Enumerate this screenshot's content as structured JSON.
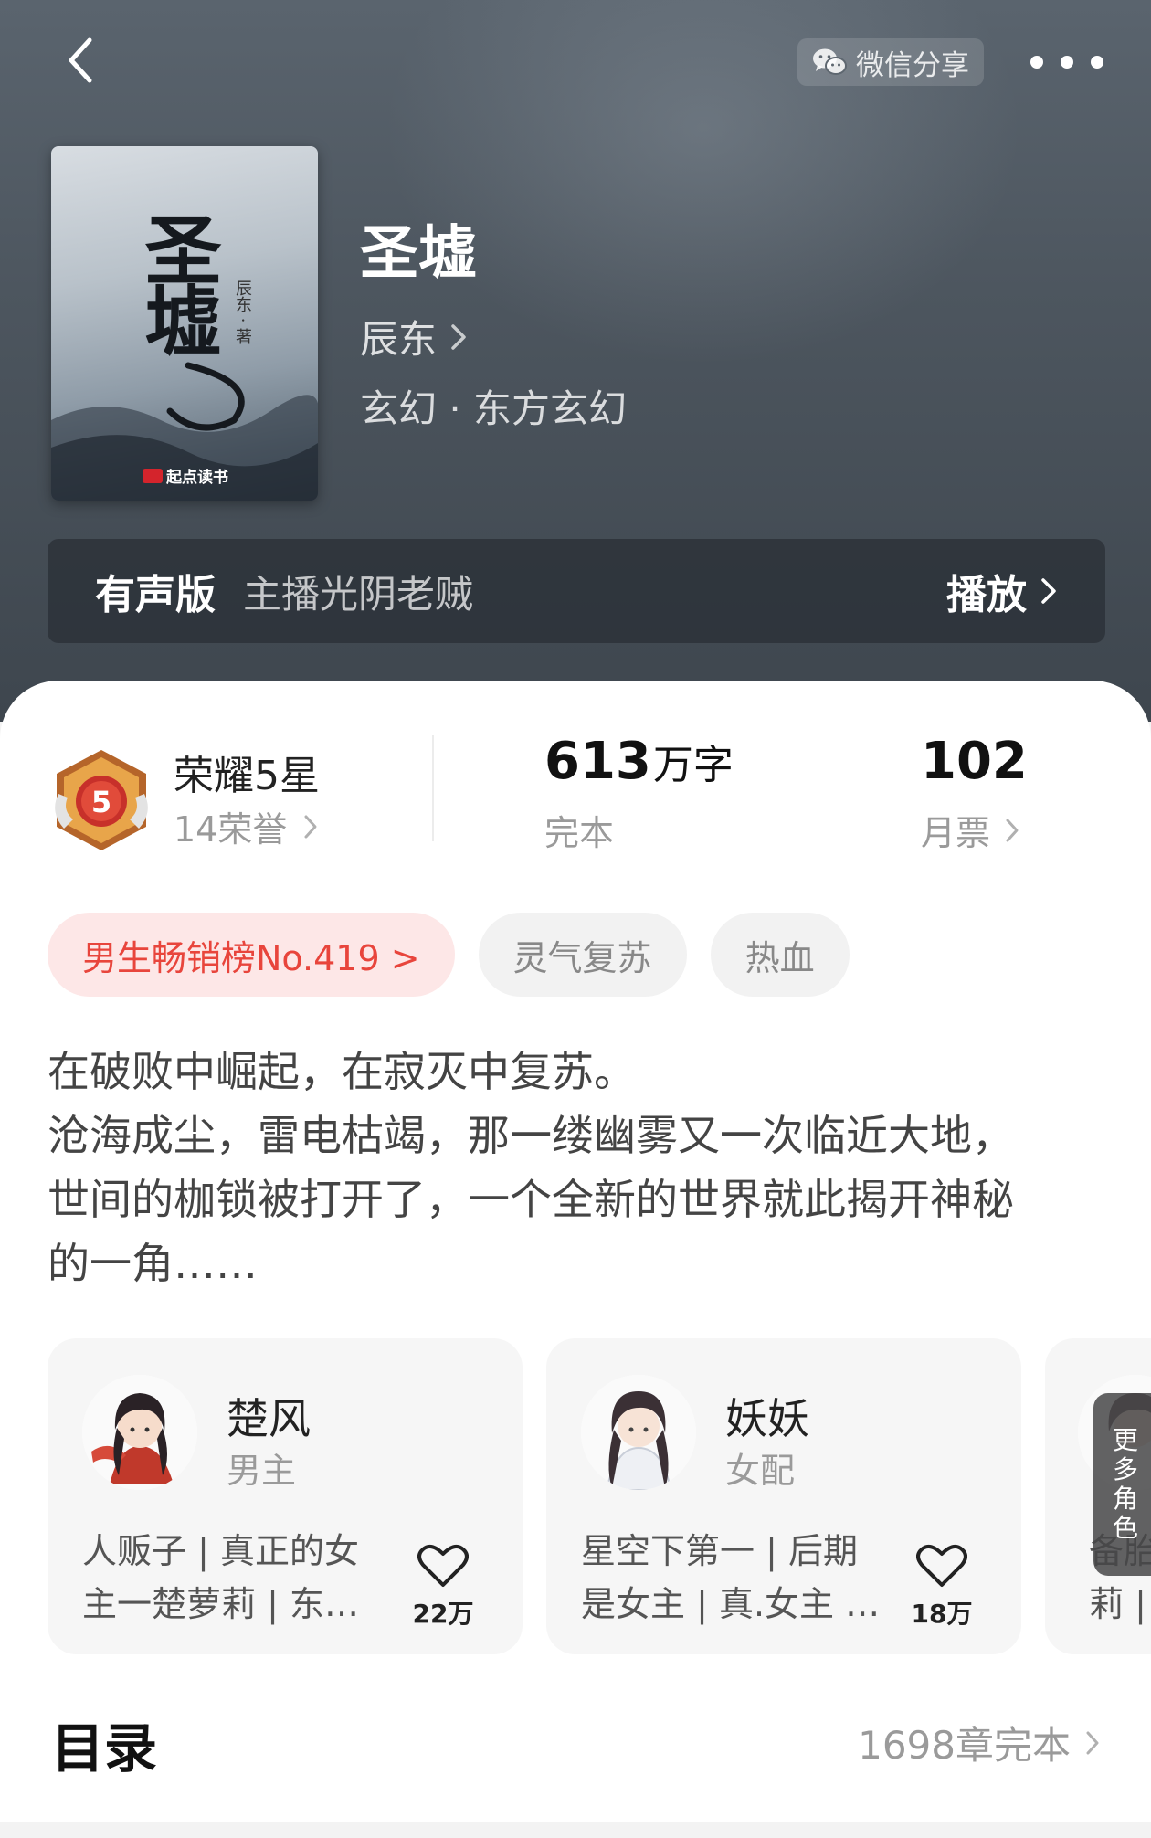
{
  "header": {
    "share_label": "微信分享",
    "icons": {
      "back": "chevron-left-icon",
      "share": "wechat-icon",
      "more": "more-dots-icon"
    }
  },
  "book": {
    "cover_title": "圣墟",
    "cover_author": "辰东 · 著",
    "cover_publisher": "起点读书",
    "title": "圣墟",
    "author": "辰东",
    "genre": "玄幻 · 东方玄幻"
  },
  "audio": {
    "label": "有声版",
    "host": "主播光阴老贼",
    "play_label": "播放"
  },
  "stats": {
    "badge_level": "5",
    "honor_title": "荣耀5星",
    "honor_count": "14荣誉",
    "word_count_value": "613",
    "word_count_unit": "万字",
    "status": "完本",
    "monthly_tickets": "102",
    "monthly_tickets_label": "月票"
  },
  "tags": [
    {
      "label": "男生畅销榜No.419 >"
    },
    {
      "label": "灵气复苏"
    },
    {
      "label": "热血"
    }
  ],
  "synopsis": [
    "在破败中崛起，在寂灭中复苏。",
    "沧海成尘，雷电枯竭，那一缕幽雾又一次临近大地，",
    "世间的枷锁被打开了，一个全新的世界就此揭开神秘",
    "的一角……"
  ],
  "characters": [
    {
      "name": "楚风",
      "role": "男主",
      "desc_line1": "人贩子 | 真正的女",
      "desc_line2": "主一楚萝莉 | 东…",
      "likes": "22万"
    },
    {
      "name": "妖妖",
      "role": "女配",
      "desc_line1": "星空下第一 | 后期",
      "desc_line2": "是女主 | 真.女主 |…",
      "likes": "18万"
    },
    {
      "name": "",
      "role": "",
      "desc_line1": "备胎",
      "desc_line2": "莉 |",
      "likes": ""
    }
  ],
  "more_roles_label": "更多角色",
  "toc": {
    "title": "目录",
    "info": "1698章完本"
  },
  "colors": {
    "accent_red": "#e8453c",
    "header_bg": "#4d565f",
    "hot_tag_bg": "#fde7e7"
  }
}
